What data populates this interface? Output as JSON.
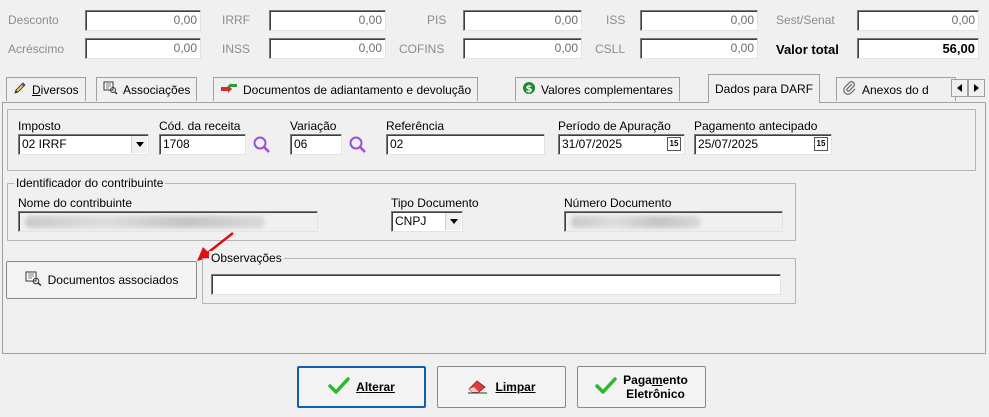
{
  "totals": {
    "desconto_label": "Desconto",
    "desconto_value": "0,00",
    "irrf_label": "IRRF",
    "irrf_value": "0,00",
    "pis_label": "PIS",
    "pis_value": "0,00",
    "iss_label": "ISS",
    "iss_value": "0,00",
    "sest_label": "Sest/Senat",
    "sest_value": "0,00",
    "acrescimo_label": "Acréscimo",
    "acrescimo_value": "0,00",
    "inss_label": "INSS",
    "inss_value": "0,00",
    "cofins_label": "COFINS",
    "cofins_value": "0,00",
    "csll_label": "CSLL",
    "csll_value": "0,00",
    "valor_total_label": "Valor total",
    "valor_total_value": "56,00"
  },
  "tabs": [
    {
      "label_u": "D",
      "label_rest": "iversos"
    },
    {
      "label": "Associações"
    },
    {
      "label": "Documentos de adiantamento e devolução"
    },
    {
      "label": "Valores complementares"
    },
    {
      "label": "Dados para DARF"
    },
    {
      "label": "Anexos do d"
    }
  ],
  "darf": {
    "imposto_label": "Imposto",
    "imposto_value": "02 IRRF",
    "cod_receita_label": "Cód. da receita",
    "cod_receita_value": "1708",
    "variacao_label": "Variação",
    "variacao_value": "06",
    "referencia_label": "Referência",
    "referencia_value": "02",
    "periodo_label": "Período de Apuração",
    "periodo_value": "31/07/2025",
    "pagamento_label": "Pagamento antecipado",
    "pagamento_value": "25/07/2025",
    "calendar_glyph": "15"
  },
  "contribuinte": {
    "group_title": "Identificador do contribuinte",
    "nome_label": "Nome do contribuinte",
    "tipo_label": "Tipo Documento",
    "tipo_value": "CNPJ",
    "numero_label": "Número Documento"
  },
  "docs_button_label": "Documentos associados",
  "observacoes_label": "Observações",
  "actions": {
    "alterar_u": "A",
    "alterar_rest": "lterar",
    "limpar_u": "L",
    "limpar_rest": "impar",
    "pagamento_line1_a": "Paga",
    "pagamento_line1_u": "m",
    "pagamento_line1_b": "ento",
    "pagamento_line2": "Eletrônico"
  }
}
